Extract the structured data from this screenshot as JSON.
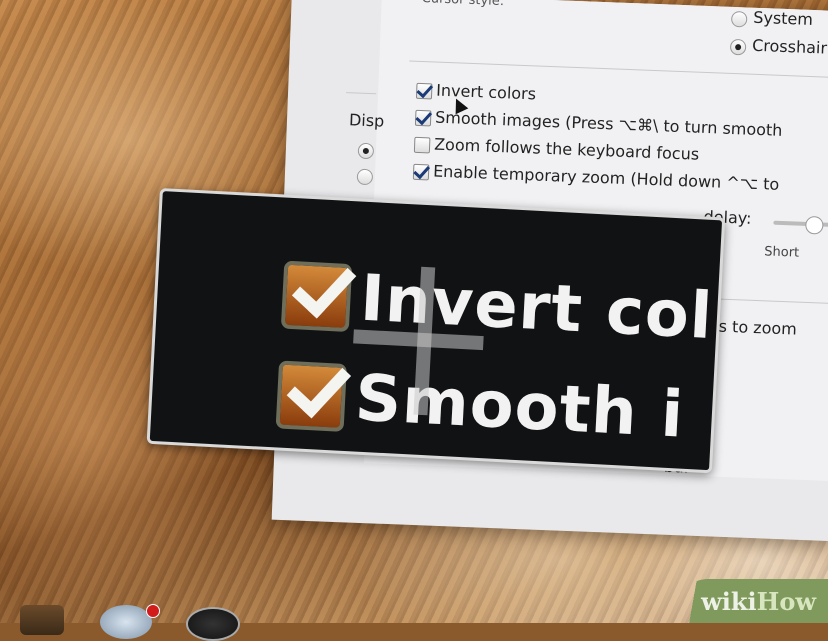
{
  "prefs": {
    "cursor_style_label": "Cursor style:",
    "radio_system": "System",
    "radio_crosshair": "Crosshair",
    "disp_label": "Disp",
    "options": [
      {
        "label": "Invert colors",
        "checked": true
      },
      {
        "label": "Smooth images (Press ⌥⌘\\ to turn smooth",
        "checked": true
      },
      {
        "label": "Zoom follows the keyboard focus",
        "checked": false
      },
      {
        "label": "Enable temporary zoom (Hold down ^⌥ to",
        "checked": true
      }
    ],
    "delay_label": "delay:",
    "short_label": "Short",
    "keys_to_zoom": "eys to zoom",
    "bar_fragment": "bar"
  },
  "zoom_window": {
    "line1": "Invert col",
    "line2": "Smooth i"
  },
  "watermark": {
    "part1": "wiki",
    "part2": "How"
  },
  "colors": {
    "checkbox_accent": "#1b3b78",
    "zoom_check_fill": "#b8621f",
    "watermark_bg": "#7f9a5c"
  },
  "icons": [
    "checkbox-icon",
    "radio-icon",
    "crosshair-icon",
    "mouse-pointer-icon",
    "dock-app-icon"
  ]
}
